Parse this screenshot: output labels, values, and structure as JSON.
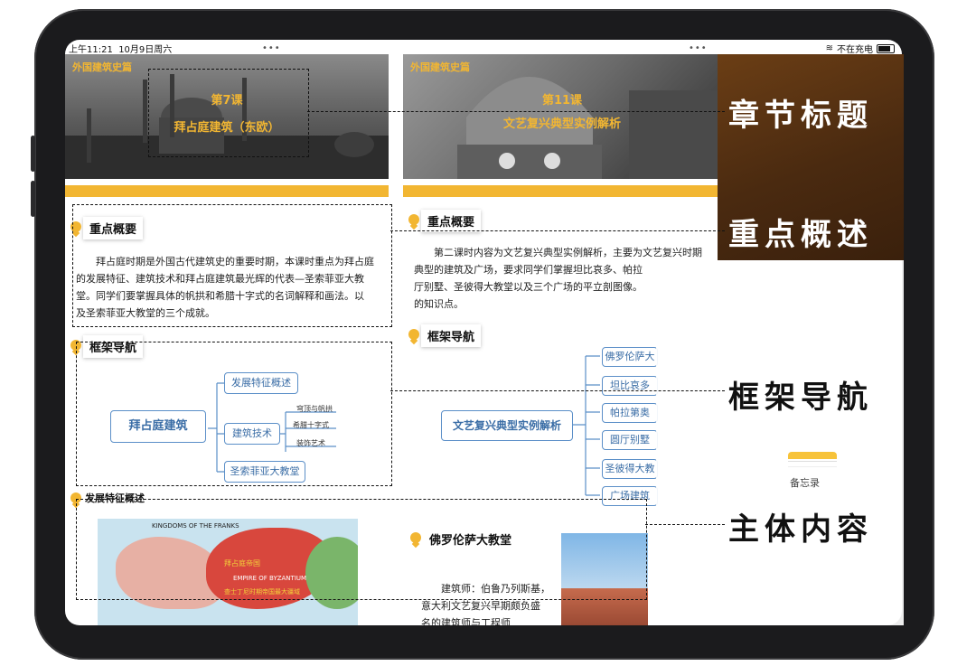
{
  "status": {
    "time": "上午11:21",
    "date": "10月9日周六",
    "charging": "不在充电",
    "dots": "•••"
  },
  "left_page": {
    "tag": "外国建筑史篇",
    "lesson_no": "第7课",
    "lesson_title": "拜占庭建筑（东欧）",
    "summary_title": "重点概要",
    "summary_lines": [
      "拜占庭时期是外国古代建筑史的重要时期，本课时重点为拜占庭",
      "的发展特征、建筑技术和拜占庭建筑最光辉的代表—圣索菲亚大教",
      "堂。同学们要掌握具体的帆拱和希腊十字式的名词解释和画法。以",
      "及圣索菲亚大教堂的三个成就。"
    ],
    "nav_title": "框架导航",
    "mindmap": {
      "root": "拜占庭建筑",
      "children": [
        "发展特征概述",
        "建筑技术",
        "圣索菲亚大教堂"
      ],
      "sub": [
        "穹顶与帆拱",
        "希腊十字式",
        "装饰艺术"
      ]
    },
    "dev_title": "发展特征概述",
    "map_labels": [
      "KINGDOMS OF THE FRANKS",
      "EMPIRE OF BYZANTIUM",
      "拜占庭帝国",
      "查士丁尼时期帝国最大疆域"
    ]
  },
  "right_page": {
    "tag": "外国建筑史篇",
    "lesson_no": "第11课",
    "lesson_title": "文艺复兴典型实例解析",
    "summary_title": "重点概要",
    "summary_lines": [
      "第二课时内容为文艺复兴典型实例解析，主要为文艺复兴时期",
      "典型的建筑及广场，要求同学们掌握坦比哀多、帕拉",
      "厅别墅、圣彼得大教堂以及三个广场的平立剖图像。",
      "的知识点。"
    ],
    "nav_title": "框架导航",
    "mindmap": {
      "root": "文艺复兴典型实例解析",
      "children": [
        "佛罗伦萨大",
        "坦比哀多",
        "帕拉第奥",
        "圆厅别墅",
        "圣彼得大教",
        "广场建筑"
      ]
    },
    "content_title": "佛罗伦萨大教堂",
    "content_lines": [
      "建筑师：伯鲁乃列斯基，",
      "意大利文艺复兴早期颇负盛",
      "名的建筑师与工程师"
    ],
    "architect_name": "伯鲁乃列斯基"
  },
  "overlay": {
    "labels": [
      "章节标题",
      "重点概述",
      "框架导航",
      "主体内容"
    ],
    "app_name": "备忘录"
  },
  "colors": {
    "accent": "#f2b632",
    "node_border": "#5b8fc8",
    "overlay_brown": "#4a2a10"
  }
}
